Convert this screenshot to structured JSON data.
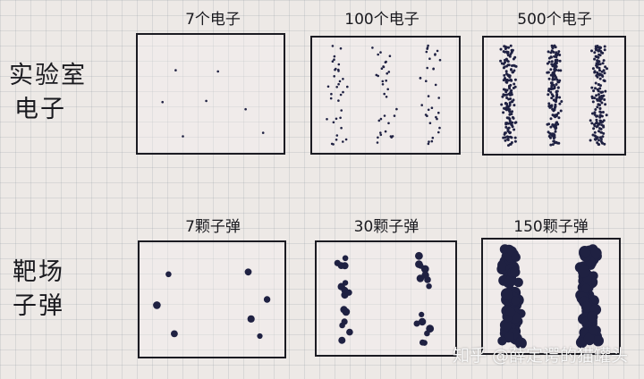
{
  "rows": [
    {
      "label_line1": "实验室",
      "label_line2": "电子"
    },
    {
      "label_line1": "靶场",
      "label_line2": "子弹"
    }
  ],
  "panels": [
    {
      "label": "7个电子",
      "dots": 7,
      "kind": "fine",
      "bands": false
    },
    {
      "label": "100个电子",
      "dots": 100,
      "kind": "fine",
      "bands": true
    },
    {
      "label": "500个电子",
      "dots": 500,
      "kind": "fine",
      "bands": true
    },
    {
      "label": "7颗子弹",
      "dots": 7,
      "kind": "bullet",
      "bands": false
    },
    {
      "label": "30颗子弹",
      "dots": 30,
      "kind": "bullet",
      "bands": false
    },
    {
      "label": "150颗子弹",
      "dots": 150,
      "kind": "bullet",
      "bands": false
    }
  ],
  "watermark": "知乎 @薛定谔的猫罐头",
  "colors": {
    "ink": "#1c1b22",
    "paper": "#ede9e6",
    "dots": "#1f2142"
  }
}
